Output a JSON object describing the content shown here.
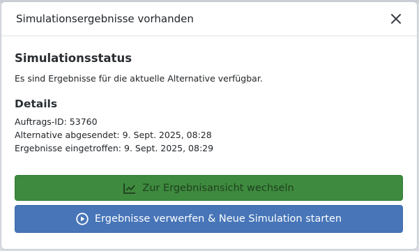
{
  "modal": {
    "title": "Simulationsergebnisse vorhanden",
    "close_icon": "close-icon"
  },
  "status": {
    "heading": "Simulationsstatus",
    "message": "Es sind Ergebnisse für die aktuelle Alternative verfügbar."
  },
  "details": {
    "heading": "Details",
    "order_id": "Auftrags-ID: 53760",
    "sent": "Alternative abgesendet: 9. Sept. 2025, 08:28",
    "received": "Ergebnisse eingetroffen: 9. Sept. 2025, 08:29"
  },
  "actions": {
    "view_label": "Zur Ergebnisansicht wechseln",
    "view_icon": "chart-line-icon",
    "view_color": "#3e8a3e",
    "discard_label": "Ergebnisse verwerfen & Neue Simulation starten",
    "discard_icon": "play-circle-icon",
    "discard_color": "#4775b8"
  }
}
